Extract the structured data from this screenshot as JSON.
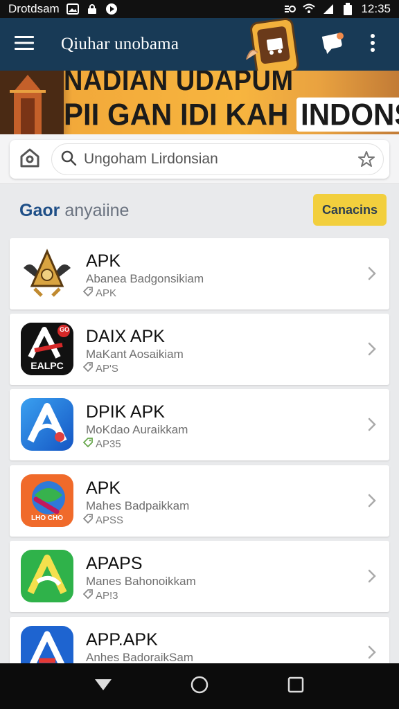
{
  "status_bar": {
    "carrier": "Drotdsam",
    "time": "12:35"
  },
  "app_bar": {
    "title": "Qiuhar unobama",
    "icons": [
      "menu-icon",
      "chat-icon",
      "more-vert-icon"
    ]
  },
  "banner": {
    "line1": "NADIAN UDAPUM",
    "line2_prefix": "PII GAN IDI KAH",
    "line2_highlight": "INDONSIA!"
  },
  "search": {
    "text": "Ungoham Lirdonsian",
    "icons": [
      "home-icon",
      "search-icon",
      "star-icon"
    ]
  },
  "section": {
    "title_accent": "Gaor",
    "title_rest": "anyaiine",
    "button_label": "Canacins"
  },
  "apps": [
    {
      "name": "APK",
      "subtitle": "Abanea Badgonsikiam",
      "tag": "APK",
      "icon": "garuda-emblem-icon"
    },
    {
      "name": "DAIX APK",
      "subtitle": "MaKant Aosaikiam",
      "tag": "AP'S",
      "icon": "galpc-app-icon",
      "icon_text": "EALPC",
      "badge_text": "GO"
    },
    {
      "name": "DPIK APK",
      "subtitle": "MoKdao Auraikkam",
      "tag": "AP35",
      "icon": "blue-a-app-icon"
    },
    {
      "name": "APK",
      "subtitle": "Mahes Badpaikkam",
      "tag": "APSS",
      "icon": "color-swirl-app-icon",
      "icon_text": "LHO CHO"
    },
    {
      "name": "APAPS",
      "subtitle": "Manes Bahonoikkam",
      "tag": "AP!3",
      "icon": "green-a-app-icon"
    },
    {
      "name": "APP.APK",
      "subtitle": "Anhes BadoraikSam",
      "tag": "",
      "icon": "blue-triangle-app-icon"
    }
  ],
  "colors": {
    "app_bar": "#183a56",
    "banner_yellow": "#f7b53f",
    "button_yellow": "#f2cf3d",
    "accent_blue": "#1f4f87"
  }
}
